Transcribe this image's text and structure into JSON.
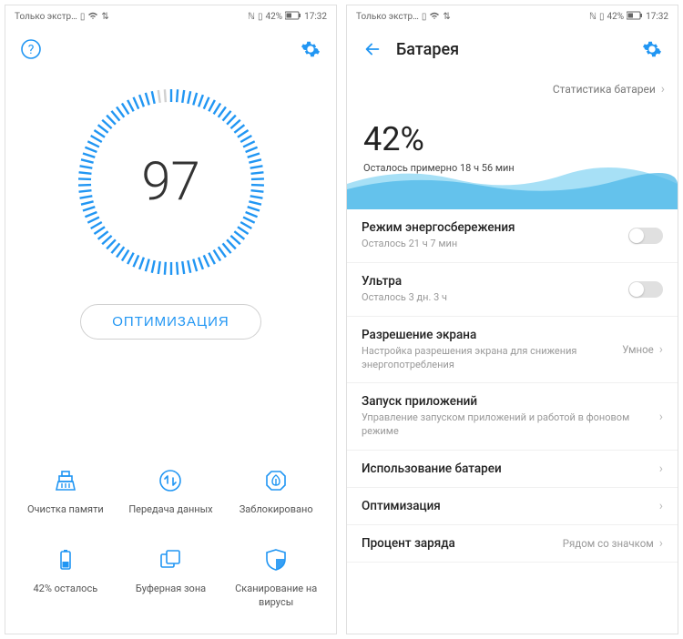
{
  "status": {
    "carrier": "Только экстр…",
    "battery_pct": "42%",
    "time": "17:32"
  },
  "screen1": {
    "score": "97",
    "optimize_label": "ОПТИМИЗАЦИЯ",
    "cells": [
      {
        "label": "Очистка памяти"
      },
      {
        "label": "Передача данных"
      },
      {
        "label": "Заблокировано"
      },
      {
        "label": "42% осталось"
      },
      {
        "label": "Буферная зона"
      },
      {
        "label": "Сканирование на вирусы"
      }
    ]
  },
  "screen2": {
    "title": "Батарея",
    "stats_link": "Статистика батареи",
    "battery_pct": "42%",
    "remaining": "Осталось примерно 18 ч 56 мин",
    "rows": {
      "power_save": {
        "title": "Режим энергосбережения",
        "sub": "Осталось 21 ч 7 мин"
      },
      "ultra": {
        "title": "Ультра",
        "sub": "Осталось 3 дн. 3 ч"
      },
      "resolution": {
        "title": "Разрешение экрана",
        "sub": "Настройка разрешения экрана для снижения энергопотребления",
        "value": "Умное"
      },
      "launch": {
        "title": "Запуск приложений",
        "sub": "Управление запуском приложений и работой в фоновом режиме"
      },
      "usage": {
        "title": "Использование батареи"
      },
      "optimize": {
        "title": "Оптимизация"
      },
      "percent": {
        "title": "Процент заряда",
        "value": "Рядом со значком"
      }
    }
  }
}
